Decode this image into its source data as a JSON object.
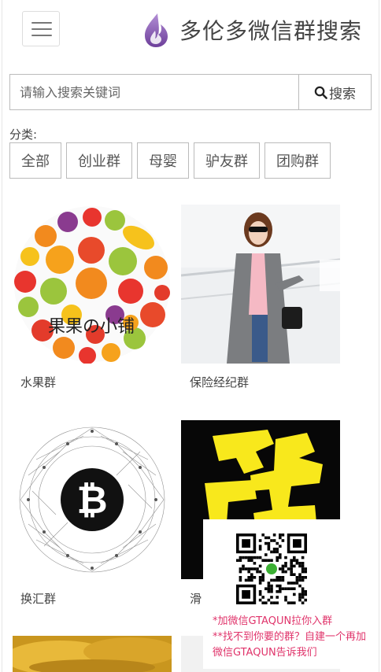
{
  "header": {
    "menu_icon": "hamburger-menu-icon",
    "logo_text": "多伦多微信群搜索"
  },
  "search": {
    "placeholder": "请输入搜索关键词",
    "button_label": "搜索",
    "button_icon": "search-icon"
  },
  "category": {
    "label": "分类:",
    "items": [
      "全部",
      "创业群",
      "母婴",
      "驴友群",
      "团购群"
    ]
  },
  "groups": [
    {
      "title": "水果群",
      "image_text": "果果の小铺"
    },
    {
      "title": "保险经纪群"
    },
    {
      "title": "换汇群"
    },
    {
      "title": "滑"
    }
  ],
  "qr": {
    "line1": "*加微信GTAQUN拉你入群",
    "line2": "**找不到你要的群？自建一个再加",
    "line3": "微信GTAQUN告诉我们"
  },
  "colors": {
    "accent_pink": "#e0346b",
    "logo_purple": "#8a5bb0",
    "border": "#bbbbbb"
  }
}
